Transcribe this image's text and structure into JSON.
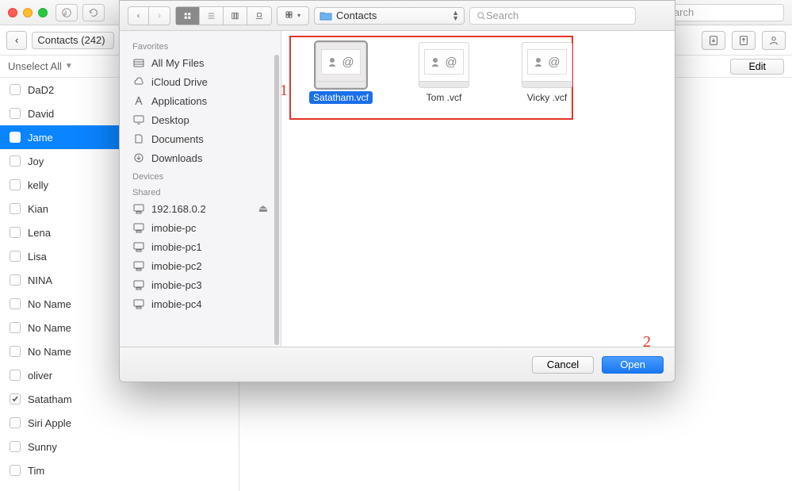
{
  "mainWindow": {
    "searchPlaceholder": "Search",
    "breadcrumbBack": "‹",
    "breadcrumbLabel": "Contacts (242)",
    "unselectLabel": "Unselect All",
    "editLabel": "Edit"
  },
  "contacts": [
    {
      "name": "DaD2",
      "checked": false,
      "selected": false
    },
    {
      "name": "David",
      "checked": false,
      "selected": false
    },
    {
      "name": "Jame",
      "checked": false,
      "selected": true
    },
    {
      "name": "Joy",
      "checked": false,
      "selected": false
    },
    {
      "name": "kelly",
      "checked": false,
      "selected": false
    },
    {
      "name": "Kian",
      "checked": false,
      "selected": false
    },
    {
      "name": "Lena",
      "checked": false,
      "selected": false
    },
    {
      "name": "Lisa",
      "checked": false,
      "selected": false
    },
    {
      "name": "NINA",
      "checked": false,
      "selected": false
    },
    {
      "name": "No Name",
      "checked": false,
      "selected": false
    },
    {
      "name": "No Name",
      "checked": false,
      "selected": false
    },
    {
      "name": "No Name",
      "checked": false,
      "selected": false
    },
    {
      "name": "oliver",
      "checked": false,
      "selected": false
    },
    {
      "name": "Satatham",
      "checked": true,
      "selected": false
    },
    {
      "name": "Siri Apple",
      "checked": false,
      "selected": false
    },
    {
      "name": "Sunny",
      "checked": false,
      "selected": false
    },
    {
      "name": "Tim",
      "checked": false,
      "selected": false
    }
  ],
  "finder": {
    "folderName": "Contacts",
    "searchPlaceholder": "Search",
    "sidebar": {
      "favoritesHeader": "Favorites",
      "favorites": [
        "All My Files",
        "iCloud Drive",
        "Applications",
        "Desktop",
        "Documents",
        "Downloads"
      ],
      "devicesHeader": "Devices",
      "sharedHeader": "Shared",
      "shared": [
        "192.168.0.2",
        "imobie-pc",
        "imobie-pc1",
        "imobie-pc2",
        "imobie-pc3",
        "imobie-pc4"
      ]
    },
    "files": [
      {
        "name": "Satatham.vcf",
        "selected": true
      },
      {
        "name": "Tom .vcf",
        "selected": false
      },
      {
        "name": "Vicky .vcf",
        "selected": false
      }
    ],
    "cancelLabel": "Cancel",
    "openLabel": "Open",
    "annotation1": "1",
    "annotation2": "2"
  }
}
